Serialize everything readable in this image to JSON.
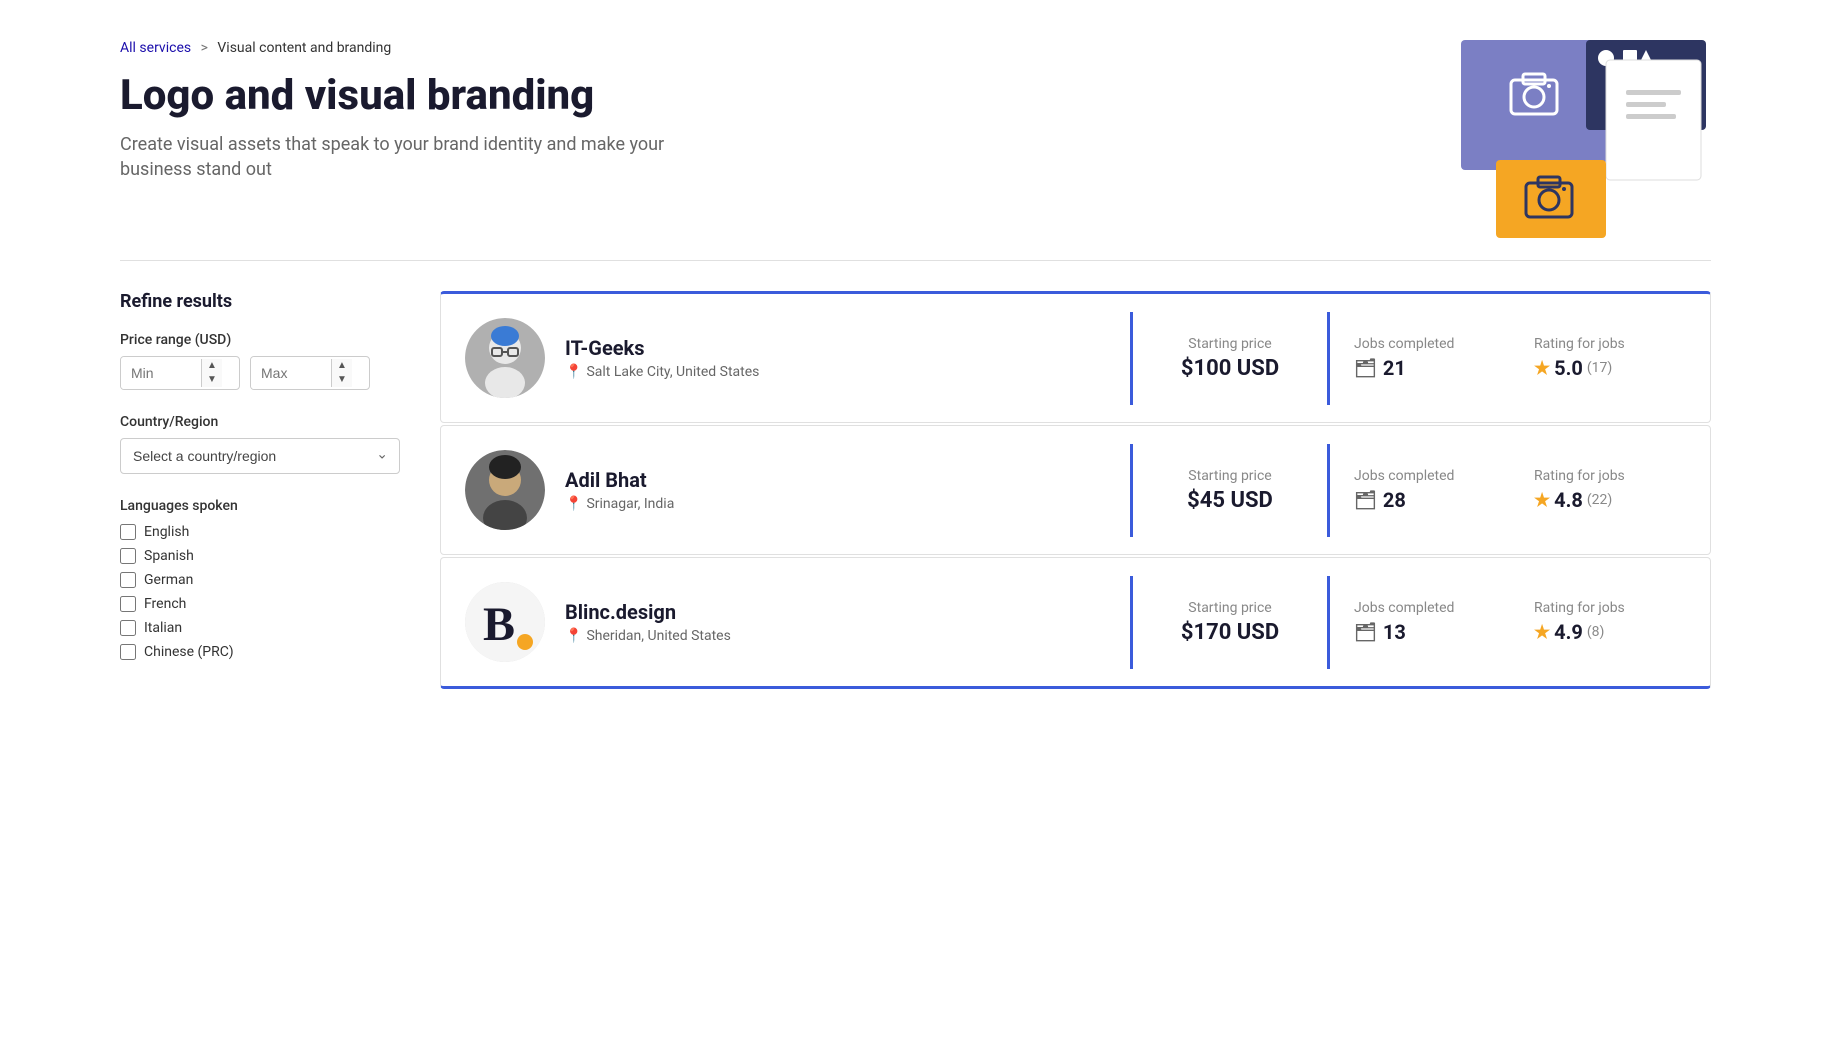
{
  "breadcrumb": {
    "all_services": "All services",
    "separator": ">",
    "current": "Visual content and branding"
  },
  "hero": {
    "title": "Logo and visual branding",
    "subtitle": "Create visual assets that speak to your brand identity and make your business stand out"
  },
  "sidebar": {
    "refine_title": "Refine results",
    "price_range_label": "Price range (USD)",
    "min_placeholder": "Min",
    "max_placeholder": "Max",
    "country_label": "Country/Region",
    "country_placeholder": "Select a country/region",
    "languages_label": "Languages spoken",
    "languages": [
      {
        "id": "lang-english",
        "label": "English"
      },
      {
        "id": "lang-spanish",
        "label": "Spanish"
      },
      {
        "id": "lang-german",
        "label": "German"
      },
      {
        "id": "lang-french",
        "label": "French"
      },
      {
        "id": "lang-italian",
        "label": "Italian"
      },
      {
        "id": "lang-chinese",
        "label": "Chinese (PRC)"
      }
    ]
  },
  "listings": {
    "columns": {
      "starting_price": "Starting price",
      "jobs_completed": "Jobs completed",
      "rating_for_jobs": "Rating for jobs"
    },
    "items": [
      {
        "id": "it-geeks",
        "name": "IT-Geeks",
        "location": "Salt Lake City, United States",
        "price": "$100 USD",
        "jobs": "21",
        "rating": "5.0",
        "rating_count": "(17)",
        "highlighted": true,
        "avatar_type": "itgeeks"
      },
      {
        "id": "adil-bhat",
        "name": "Adil Bhat",
        "location": "Srinagar, India",
        "price": "$45 USD",
        "jobs": "28",
        "rating": "4.8",
        "rating_count": "(22)",
        "highlighted": true,
        "avatar_type": "adil"
      },
      {
        "id": "blinc-design",
        "name": "Blinc.design",
        "location": "Sheridan, United States",
        "price": "$170 USD",
        "jobs": "13",
        "rating": "4.9",
        "rating_count": "(8)",
        "highlighted": true,
        "avatar_type": "blinc"
      }
    ]
  }
}
